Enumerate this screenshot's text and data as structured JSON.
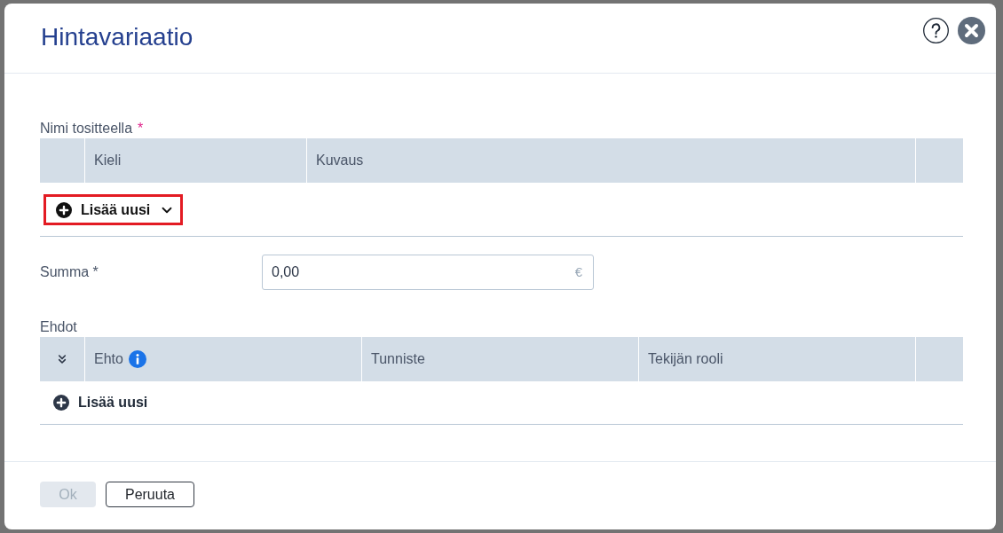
{
  "dialog": {
    "title": "Hintavariaatio"
  },
  "name_section": {
    "label": "Nimi tositteella",
    "required_mark": "*",
    "columns": [
      {
        "kind": "spacer"
      },
      {
        "kind": "text",
        "label": "Kieli",
        "info": false
      },
      {
        "kind": "text",
        "label": "Kuvaus",
        "info": false
      },
      {
        "kind": "spacer"
      }
    ],
    "add_button": {
      "label": "Lisää uusi",
      "highlighted": true,
      "dropdown": true
    }
  },
  "amount": {
    "label": "Summa *",
    "value": "0,00",
    "unit": "€"
  },
  "conditions": {
    "label": "Ehdot",
    "columns": [
      {
        "kind": "expand"
      },
      {
        "kind": "text",
        "label": "Ehto",
        "info": true
      },
      {
        "kind": "text",
        "label": "Tunniste",
        "info": false
      },
      {
        "kind": "text",
        "label": "Tekijän rooli",
        "info": false
      },
      {
        "kind": "spacer"
      }
    ],
    "add_button": {
      "label": "Lisää uusi",
      "highlighted": false,
      "dropdown": false
    }
  },
  "footer": {
    "buttons": [
      {
        "label": "Ok",
        "disabled": true
      },
      {
        "label": "Peruuta",
        "disabled": false
      }
    ]
  }
}
